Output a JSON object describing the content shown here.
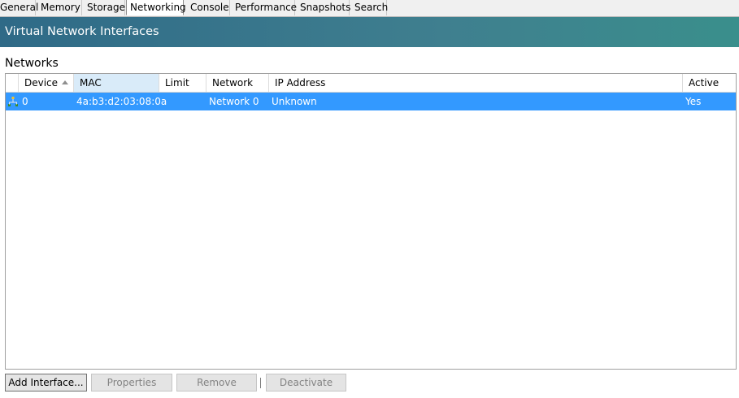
{
  "tabs": [
    {
      "label": "General"
    },
    {
      "label": "Memory"
    },
    {
      "label": "Storage"
    },
    {
      "label": "Networking",
      "active": true
    },
    {
      "label": "Console"
    },
    {
      "label": "Performance"
    },
    {
      "label": "Snapshots"
    },
    {
      "label": "Search"
    }
  ],
  "header": {
    "title": "Virtual Network Interfaces"
  },
  "section": {
    "label": "Networks"
  },
  "table": {
    "columns": [
      "Device",
      "MAC",
      "Limit",
      "Network",
      "IP Address",
      "Active"
    ],
    "sorted_column": "Device",
    "rows": [
      {
        "device": "0",
        "mac": "4a:b3:d2:03:08:0a",
        "limit": "",
        "network": "Network 0",
        "ip": "Unknown",
        "active": "Yes",
        "icon": "network-interface-icon"
      }
    ]
  },
  "buttons": {
    "add": "Add Interface...",
    "properties": "Properties",
    "remove": "Remove",
    "deactivate": "Deactivate"
  },
  "colors": {
    "header_gradient_start": "#2f6a87",
    "header_gradient_end": "#3a8f8c",
    "selection": "#3399ff"
  }
}
